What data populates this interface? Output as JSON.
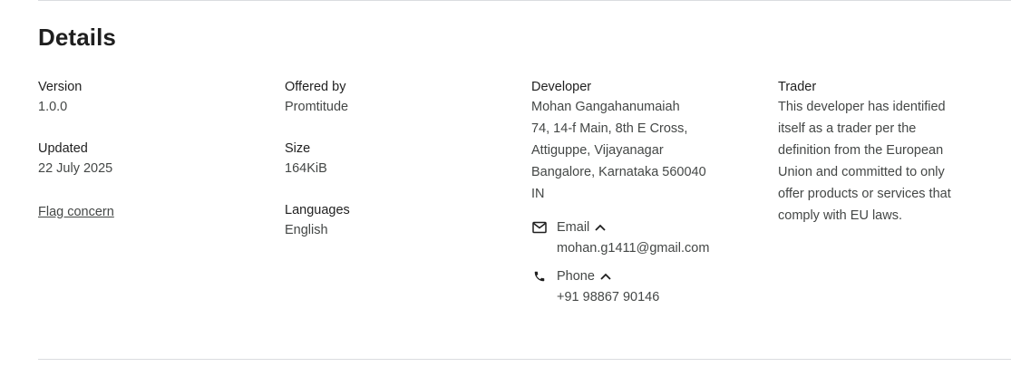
{
  "section": {
    "title": "Details"
  },
  "version": {
    "label": "Version",
    "value": "1.0.0"
  },
  "updated": {
    "label": "Updated",
    "value": "22 July 2025"
  },
  "flag_concern": {
    "label": "Flag concern"
  },
  "offered_by": {
    "label": "Offered by",
    "value": "Promtitude"
  },
  "size": {
    "label": "Size",
    "value": "164KiB"
  },
  "languages": {
    "label": "Languages",
    "value": "English"
  },
  "developer": {
    "label": "Developer",
    "address_lines": [
      "Mohan Gangahanumaiah",
      "74, 14-f Main, 8th E Cross,",
      "Attiguppe, Vijayanagar",
      "Bangalore, Karnataka 560040",
      "IN"
    ],
    "email": {
      "label": "Email",
      "value": "mohan.g1411@gmail.com",
      "icon": "mail-icon"
    },
    "phone": {
      "label": "Phone",
      "value": "+91 98867 90146",
      "icon": "phone-icon"
    }
  },
  "trader": {
    "label": "Trader",
    "text_lines": [
      "This developer has identified",
      "itself as a trader per the",
      "definition from the European",
      "Union and committed to only",
      "offer products or services that",
      "comply with EU laws."
    ]
  }
}
